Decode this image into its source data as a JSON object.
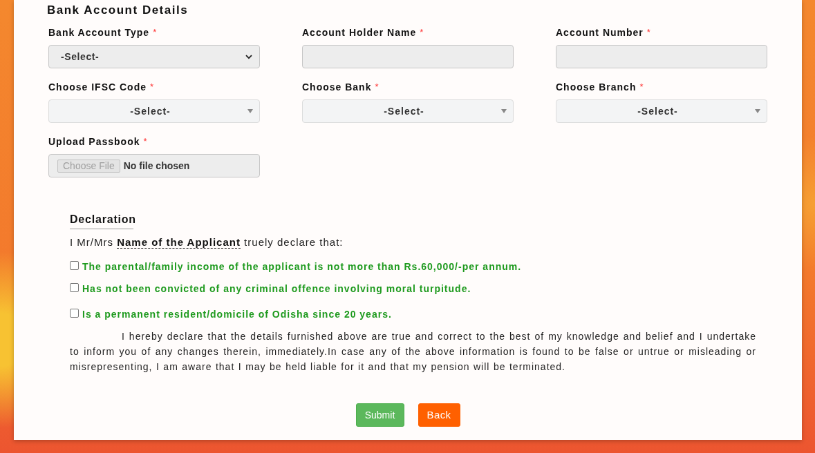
{
  "section_title": "Bank Account Details",
  "fields": [
    {
      "label": "Bank Account Type",
      "required_mark": "*",
      "kind": "select",
      "value": "-Select-"
    },
    {
      "label": "Account Holder Name",
      "required_mark": "*",
      "kind": "text"
    },
    {
      "label": "Account Number",
      "required_mark": "*",
      "kind": "text"
    },
    {
      "label": "Choose IFSC Code",
      "required_mark": "*",
      "kind": "searchable-select",
      "value": "-Select-"
    },
    {
      "label": "Choose Bank",
      "required_mark": "*",
      "kind": "searchable-select",
      "value": "-Select-"
    },
    {
      "label": "Choose Branch",
      "required_mark": "*",
      "kind": "searchable-select",
      "value": "-Select-"
    },
    {
      "label": "Upload Passbook",
      "required_mark": "*",
      "kind": "file",
      "button": "Choose File",
      "value": "No file chosen"
    }
  ],
  "declaration": {
    "title": "Declaration",
    "intro": "I Mr/Mrs **Name of the Applicant** truely declare that:",
    "statements": [
      {
        "text": "The parental/family income of the applicant is not more than Rs.60,000/-per annum.",
        "checked": false
      },
      {
        "text": "Has not been convicted of any criminal offence involving moral turpitude.",
        "checked": false
      },
      {
        "text": "Is a permanent resident/domicile of Odisha since 20 years.",
        "checked": false
      }
    ],
    "body": "I hereby declare that the details furnished above are true and correct to the best of my knowledge and belief and I undertake to inform you of any changes therein, immediately.In case any of the above information is found to be false or untrue or misleading or misrepresenting, I am aware that I may be held liable for it and that my pension will be terminated."
  },
  "buttons": [
    {
      "label": "Submit",
      "kind": "submit"
    },
    {
      "label": "Back",
      "kind": "back"
    }
  ]
}
